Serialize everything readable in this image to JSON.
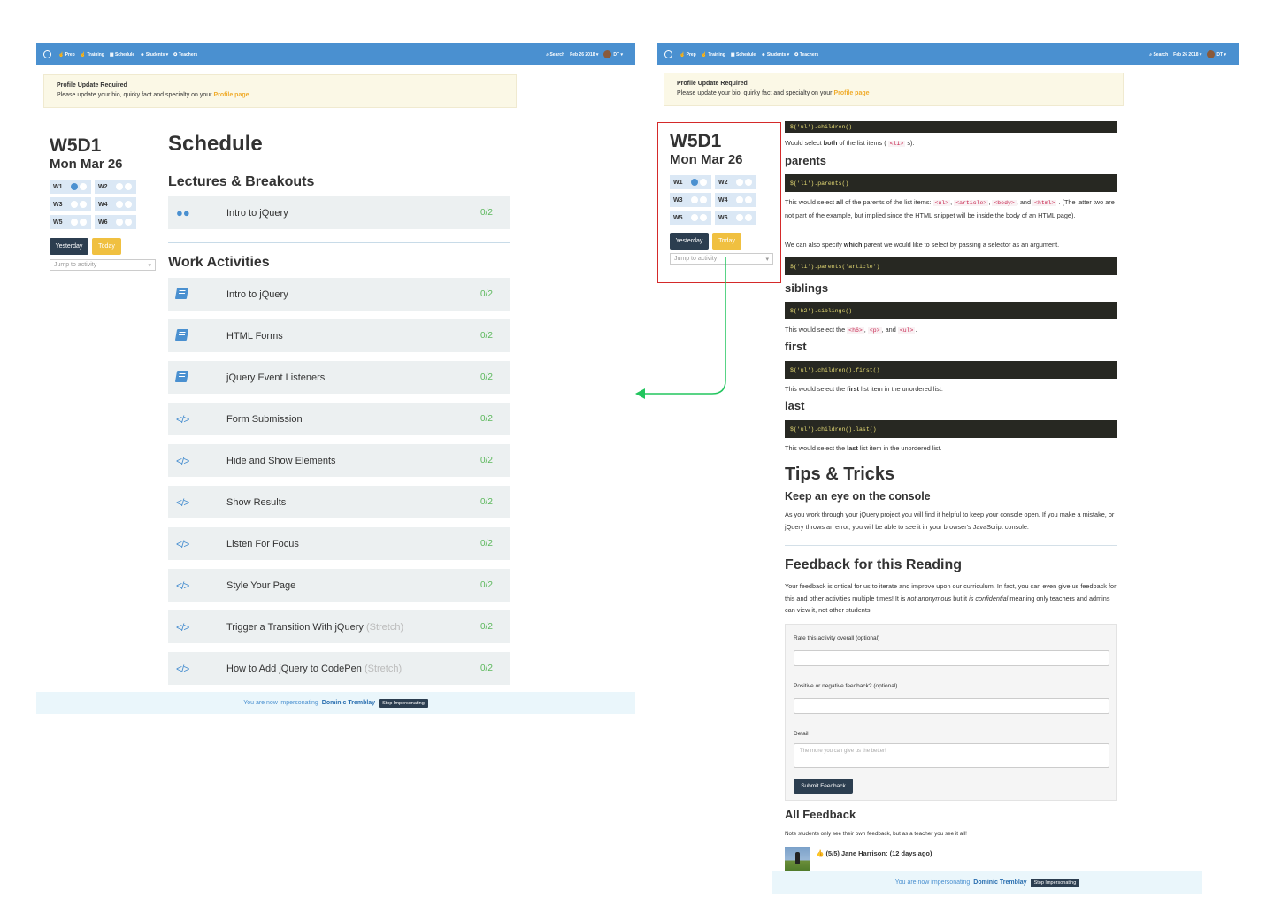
{
  "nav": {
    "items": [
      "Prep",
      "Training",
      "Schedule",
      "Students",
      "Teachers"
    ],
    "search": "Search",
    "date": "Feb 26 2018",
    "user": "DT"
  },
  "alert": {
    "title": "Profile Update Required",
    "text": "Please update your bio, quirky fact and specialty on your",
    "link": "Profile page"
  },
  "sidebar": {
    "title": "W5D1",
    "date": "Mon Mar 26",
    "weeks": [
      {
        "label": "W1",
        "dots": [
          true,
          false
        ]
      },
      {
        "label": "W2",
        "dots": [
          false,
          false
        ]
      },
      {
        "label": "W3",
        "dots": [
          false,
          false
        ]
      },
      {
        "label": "W4",
        "dots": [
          false,
          false
        ]
      },
      {
        "label": "W5",
        "dots": [
          false,
          false
        ]
      },
      {
        "label": "W6",
        "dots": [
          false,
          false
        ]
      }
    ],
    "yesterday": "Yesterday",
    "today": "Today",
    "jump_placeholder": "Jump to activity"
  },
  "schedule": {
    "title": "Schedule",
    "lectures_heading": "Lectures & Breakouts",
    "lectures": [
      {
        "name": "Intro to jQuery",
        "count": "0/2",
        "icon": "users-icon"
      }
    ],
    "work_heading": "Work Activities",
    "work": [
      {
        "name": "Intro to jQuery",
        "stretch": "",
        "count": "0/2",
        "icon": "book-icon"
      },
      {
        "name": "HTML Forms",
        "stretch": "",
        "count": "0/2",
        "icon": "book-icon"
      },
      {
        "name": "jQuery Event Listeners",
        "stretch": "",
        "count": "0/2",
        "icon": "book-icon"
      },
      {
        "name": "Form Submission",
        "stretch": "",
        "count": "0/2",
        "icon": "code-icon"
      },
      {
        "name": "Hide and Show Elements",
        "stretch": "",
        "count": "0/2",
        "icon": "code-icon"
      },
      {
        "name": "Show Results",
        "stretch": "",
        "count": "0/2",
        "icon": "code-icon"
      },
      {
        "name": "Listen For Focus",
        "stretch": "",
        "count": "0/2",
        "icon": "code-icon"
      },
      {
        "name": "Style Your Page",
        "stretch": "",
        "count": "0/2",
        "icon": "code-icon"
      },
      {
        "name": "Trigger a Transition With jQuery",
        "stretch": "(Stretch)",
        "count": "0/2",
        "icon": "code-icon"
      },
      {
        "name": "How to Add jQuery to CodePen",
        "stretch": "(Stretch)",
        "count": "0/2",
        "icon": "code-icon"
      }
    ]
  },
  "impersonation": {
    "text": "You are now impersonating",
    "name": "Dominic Tremblay",
    "stop": "Stop Impersonating"
  },
  "reading": {
    "code_children": "$('ul').children()",
    "both_text_a": "Would select",
    "both_bold": "both",
    "both_text_b": "of the list items (",
    "both_tag": "<li>",
    "both_text_c": "s).",
    "parents_heading": "parents",
    "code_parents": "$('li').parents()",
    "parents_text_a": "This would select",
    "parents_bold": "all",
    "parents_text_b": "of the parents of the list items:",
    "parents_tags": [
      "<ul>",
      "<article>",
      "<body>",
      "<html>"
    ],
    "parents_text_c": ". (The latter two are not part of the example, but implied since the HTML snippet will be inside the body of an HTML page).",
    "which_text_a": "We can also specify",
    "which_bold": "which",
    "which_text_b": "parent we would like to select by passing a selector as an argument.",
    "code_parents_article": "$('li').parents('article')",
    "siblings_heading": "siblings",
    "code_siblings": "$('h2').siblings()",
    "siblings_text_a": "This would select the",
    "siblings_tags": [
      "<h6>",
      "<p>",
      "<ul>"
    ],
    "siblings_and": ", and",
    "first_heading": "first",
    "code_first": "$('ul').children().first()",
    "first_text_a": "This would select the",
    "first_bold": "first",
    "first_text_b": "list item in the unordered list.",
    "last_heading": "last",
    "code_last": "$('ul').children().last()",
    "last_text_a": "This would select the",
    "last_bold": "last",
    "last_text_b": "list item in the unordered list.",
    "tips_heading": "Tips & Tricks",
    "console_heading": "Keep an eye on the console",
    "console_text": "As you work through your jQuery project you will find it helpful to keep your console open. If you make a mistake, or jQuery throws an error, you will be able to see it in your browser's JavaScript console.",
    "feedback_heading": "Feedback for this Reading",
    "feedback_text_a": "Your feedback is critical for us to iterate and improve upon our curriculum. In fact, you can even give us feedback for this and other activities multiple times! It is",
    "feedback_em1": "not anonymous",
    "feedback_text_b": "but it",
    "feedback_em2": "is confidential",
    "feedback_text_c": "meaning only teachers and admins can view it, not other students."
  },
  "feedback_form": {
    "rate_label": "Rate this activity overall (optional)",
    "positive_label": "Positive or negative feedback? (optional)",
    "detail_label": "Detail",
    "detail_placeholder": "The more you can give us the better!",
    "submit": "Submit Feedback"
  },
  "all_feedback": {
    "heading": "All Feedback",
    "note": "Note students only see their own feedback, but as a teacher you see it all!",
    "entry_rating": "(5/5)",
    "entry_name": "Jane Harrison:",
    "entry_time": "(12 days ago)"
  },
  "colors": {
    "navbar": "#4a90d0",
    "accent_yellow": "#f0c040",
    "dark_button": "#2c3e50",
    "count_green": "#5cb85c",
    "annotation_red": "#d42a2a",
    "arrow_green": "#22c55e"
  }
}
